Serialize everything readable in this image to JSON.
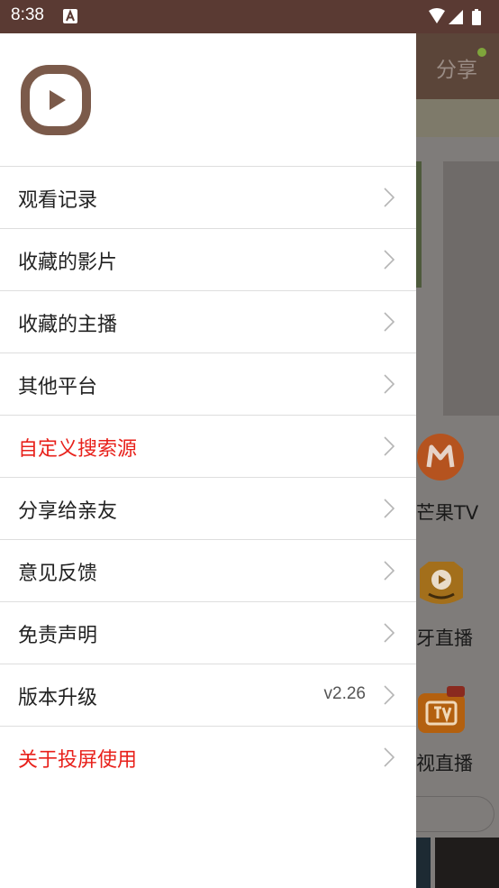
{
  "status_bar": {
    "time": "8:38"
  },
  "background": {
    "share_label": "分享",
    "labels": [
      "芒果TV",
      "牙直播",
      "视直播"
    ]
  },
  "drawer": {
    "menu": [
      {
        "label": "观看记录",
        "highlight": false,
        "value": ""
      },
      {
        "label": "收藏的影片",
        "highlight": false,
        "value": ""
      },
      {
        "label": "收藏的主播",
        "highlight": false,
        "value": ""
      },
      {
        "label": "其他平台",
        "highlight": false,
        "value": ""
      },
      {
        "label": "自定义搜索源",
        "highlight": true,
        "value": ""
      },
      {
        "label": "分享给亲友",
        "highlight": false,
        "value": ""
      },
      {
        "label": "意见反馈",
        "highlight": false,
        "value": ""
      },
      {
        "label": "免责声明",
        "highlight": false,
        "value": ""
      },
      {
        "label": "版本升级",
        "highlight": false,
        "value": "v2.26"
      },
      {
        "label": "关于投屏使用",
        "highlight": true,
        "value": ""
      }
    ]
  },
  "colors": {
    "brand": "#7b5a4a",
    "highlight_text": "#e8211b",
    "status_bar": "#5a3a33"
  }
}
